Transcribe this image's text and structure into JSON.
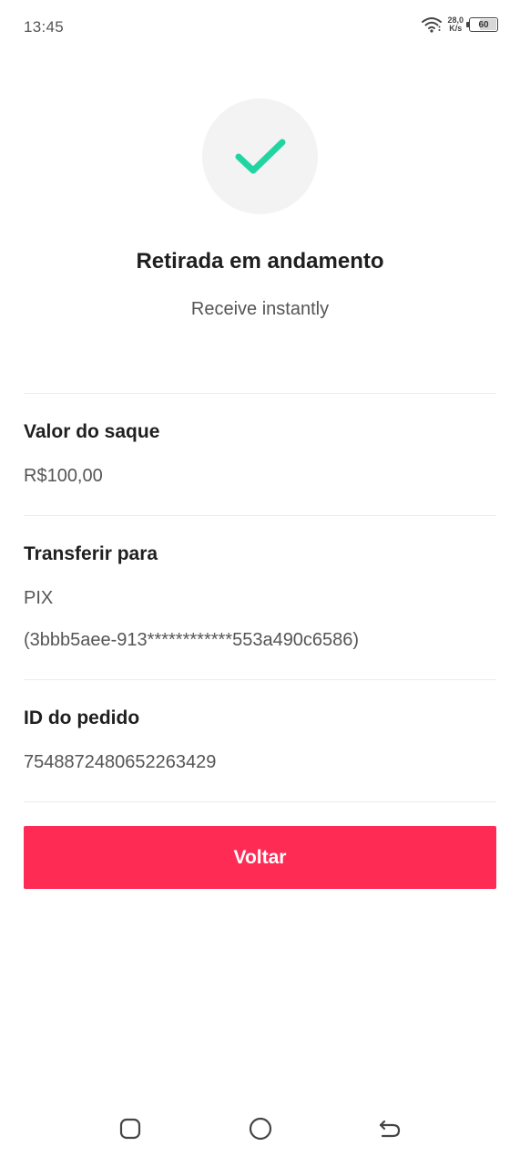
{
  "status_bar": {
    "time": "13:45",
    "net_speed_value": "28,0",
    "net_speed_unit": "K/s",
    "battery_level": "60",
    "icons": [
      "wifi-icon",
      "battery-icon"
    ]
  },
  "header": {
    "icon": "checkmark-icon",
    "accent_color": "#20d5a2",
    "title": "Retirada em andamento",
    "subtitle": "Receive instantly"
  },
  "details": {
    "amount": {
      "label": "Valor do saque",
      "value": "R$100,00"
    },
    "transfer": {
      "label": "Transferir para",
      "method": "PIX",
      "account": "(3bbb5aee-913************553a490c6586)"
    },
    "order": {
      "label": "ID do pedido",
      "value": "7548872480652263429"
    }
  },
  "actions": {
    "back_label": "Voltar",
    "button_color": "#fe2c55"
  },
  "nav_bar": {
    "icons": [
      "recents-icon",
      "home-icon",
      "back-icon"
    ]
  }
}
